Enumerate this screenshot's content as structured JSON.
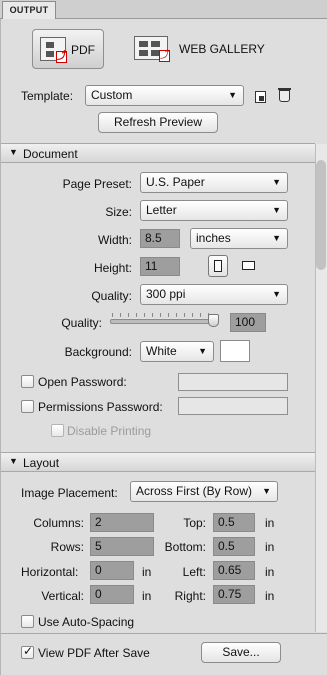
{
  "tab": {
    "label": "OUTPUT"
  },
  "modes": {
    "pdf": "PDF",
    "web": "WEB GALLERY"
  },
  "template": {
    "label": "Template:",
    "value": "Custom",
    "refresh": "Refresh Preview"
  },
  "document": {
    "header": "Document",
    "page_preset_label": "Page Preset:",
    "page_preset": "U.S. Paper",
    "size_label": "Size:",
    "size": "Letter",
    "width_label": "Width:",
    "width": "8.5",
    "units": "inches",
    "height_label": "Height:",
    "height": "11",
    "quality_label": "Quality:",
    "quality": "300 ppi",
    "quality_slider_label": "Quality:",
    "quality_value": "100",
    "quality_level": 1.0,
    "background_label": "Background:",
    "background": "White",
    "background_color": "#ffffff",
    "open_password": "Open Password:",
    "permissions_password": "Permissions Password:",
    "disable_printing": "Disable Printing"
  },
  "layout": {
    "header": "Layout",
    "placement_label": "Image Placement:",
    "placement": "Across First (By Row)",
    "columns_label": "Columns:",
    "columns": "2",
    "rows_label": "Rows:",
    "rows": "5",
    "horizontal_label": "Horizontal:",
    "horizontal": "0",
    "vertical_label": "Vertical:",
    "vertical": "0",
    "top_label": "Top:",
    "top": "0.5",
    "bottom_label": "Bottom:",
    "bottom": "0.5",
    "left_label": "Left:",
    "left": "0.65",
    "right_label": "Right:",
    "right": "0.75",
    "unit_in": "in",
    "auto_spacing": "Use Auto-Spacing"
  },
  "footer": {
    "view_pdf": "View PDF After Save",
    "save": "Save..."
  }
}
